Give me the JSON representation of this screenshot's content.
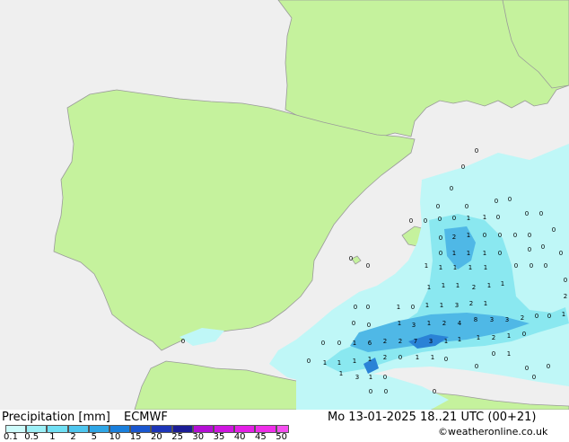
{
  "map": {
    "land_color": "#c5f29d",
    "sea_color": "#efefef",
    "border_color": "#9a9a9a",
    "precip_light_color": "#bff7f7",
    "precip_mid_color": "#8ae8f0",
    "precip_strong_color": "#4fb8e6",
    "precip_heavy_color": "#2a82d6"
  },
  "legend": {
    "title": "Precipitation [mm]",
    "model": "ECMWF",
    "ticks": [
      "0.1",
      "0.5",
      "1",
      "2",
      "5",
      "10",
      "15",
      "20",
      "25",
      "30",
      "35",
      "40",
      "45",
      "50"
    ],
    "colors": [
      "#cdfbfb",
      "#9cf0f7",
      "#6fdff4",
      "#4ec6ef",
      "#2fa6e6",
      "#1a7fdc",
      "#1a56cf",
      "#1d35b8",
      "#1c1d96",
      "#b40fd4",
      "#cf16e0",
      "#e41fe6",
      "#ef2ee9",
      "#f54ff0"
    ]
  },
  "footer": {
    "datetime": "Mo 13-01-2025 18..21 UTC (00+21)",
    "credit": "©weatheronline.co.uk"
  }
}
